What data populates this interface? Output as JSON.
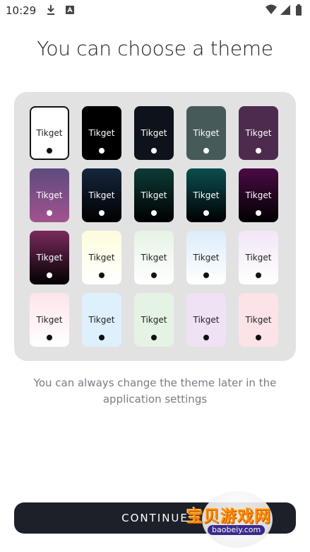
{
  "status_bar": {
    "time": "10:29",
    "icons": [
      "download-icon",
      "sim-notification-icon",
      "wifi-icon",
      "signal-icon",
      "battery-icon"
    ]
  },
  "title": "You can choose a theme",
  "themes": [
    {
      "label": "Tikget",
      "bg": "#ffffff",
      "bg2": "#ffffff",
      "text": "#222222",
      "dot": "#111111",
      "selected": true
    },
    {
      "label": "Tikget",
      "bg": "#000000",
      "bg2": "#000000",
      "text": "#ffffff",
      "dot": "#ffffff"
    },
    {
      "label": "Tikget",
      "bg": "#0e121a",
      "bg2": "#0e121a",
      "text": "#ffffff",
      "dot": "#ffffff"
    },
    {
      "label": "Tikget",
      "bg": "#465a59",
      "bg2": "#465a59",
      "text": "#ffffff",
      "dot": "#ffffff"
    },
    {
      "label": "Tikget",
      "bg": "#4d2b4e",
      "bg2": "#4d2b4e",
      "text": "#ffffff",
      "dot": "#ffffff"
    },
    {
      "label": "Tikget",
      "bg": "#5e4b7e",
      "bg2": "#a2528f",
      "text": "#ffffff",
      "dot": "#ffffff"
    },
    {
      "label": "Tikget",
      "bg": "#15263e",
      "bg2": "#000000",
      "text": "#ffffff",
      "dot": "#ffffff"
    },
    {
      "label": "Tikget",
      "bg": "#0d3b36",
      "bg2": "#000000",
      "text": "#ffffff",
      "dot": "#ffffff"
    },
    {
      "label": "Tikget",
      "bg": "#0c4e50",
      "bg2": "#000000",
      "text": "#ffffff",
      "dot": "#ffffff"
    },
    {
      "label": "Tikget",
      "bg": "#4a0b45",
      "bg2": "#000000",
      "text": "#ffffff",
      "dot": "#ffffff"
    },
    {
      "label": "Tikget",
      "bg": "#7b2a5c",
      "bg2": "#000000",
      "text": "#ffffff",
      "dot": "#ffffff"
    },
    {
      "label": "Tikget",
      "bg": "#fefcdc",
      "bg2": "#ffffff",
      "text": "#222222",
      "dot": "#111111"
    },
    {
      "label": "Tikget",
      "bg": "#e6f3e6",
      "bg2": "#ffffff",
      "text": "#222222",
      "dot": "#111111"
    },
    {
      "label": "Tikget",
      "bg": "#dcecfa",
      "bg2": "#ffffff",
      "text": "#222222",
      "dot": "#111111"
    },
    {
      "label": "Tikget",
      "bg": "#f2e6f6",
      "bg2": "#ffffff",
      "text": "#222222",
      "dot": "#111111"
    },
    {
      "label": "Tikget",
      "bg": "#fde4ea",
      "bg2": "#ffffff",
      "text": "#222222",
      "dot": "#111111"
    },
    {
      "label": "Tikget",
      "bg": "#def0fb",
      "bg2": "#def0fb",
      "text": "#222222",
      "dot": "#111111"
    },
    {
      "label": "Tikget",
      "bg": "#e5f3e5",
      "bg2": "#e5f3e5",
      "text": "#222222",
      "dot": "#111111"
    },
    {
      "label": "Tikget",
      "bg": "#efe2f5",
      "bg2": "#efe2f5",
      "text": "#222222",
      "dot": "#111111"
    },
    {
      "label": "Tikget",
      "bg": "#fbe3e8",
      "bg2": "#fbe3e8",
      "text": "#222222",
      "dot": "#111111"
    }
  ],
  "subtitle": "You can always change the theme later in the application settings",
  "continue_label": "CONTINUE",
  "watermark": {
    "text": "宝贝游戏网",
    "url": "baobeiy.com"
  },
  "colors": {
    "panel": "#e2e2e2",
    "button": "#1d2029",
    "title": "#202228",
    "subtitle": "#7a7c82"
  }
}
